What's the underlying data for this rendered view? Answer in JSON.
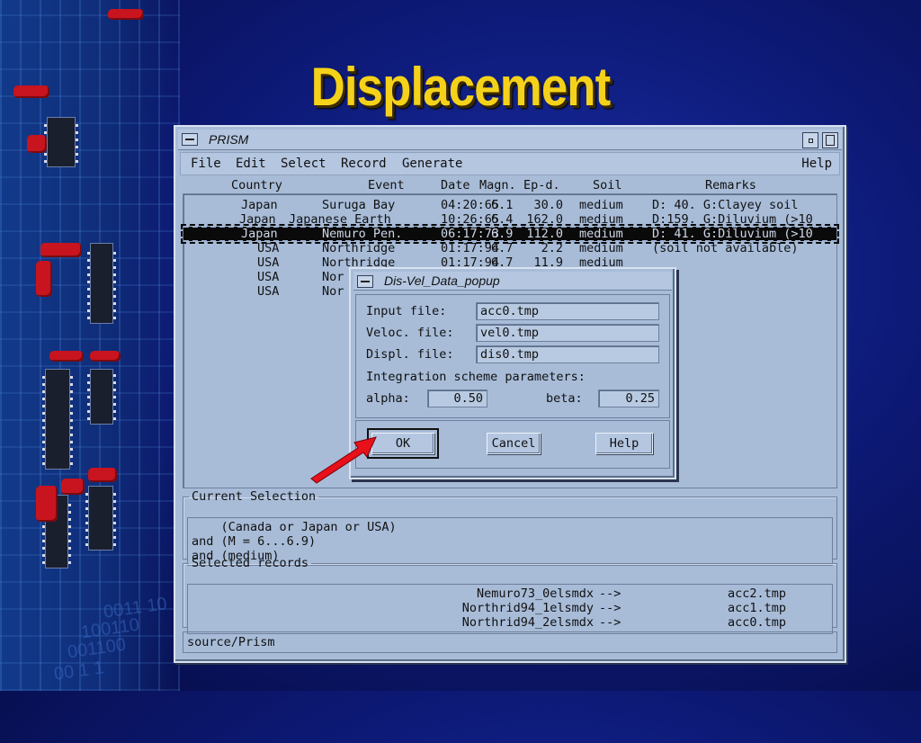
{
  "slide_title": "Displacement",
  "decor_text": [
    "0011 10",
    "100110",
    "001100",
    "00 1 1"
  ],
  "window": {
    "title": "PRISM",
    "menu": [
      "File",
      "Edit",
      "Select",
      "Record",
      "Generate"
    ],
    "help_menu": "Help",
    "columns": {
      "country": "Country",
      "event": "Event",
      "date": "Date",
      "magn": "Magn.",
      "epd": "Ep-d.",
      "soil": "Soil",
      "remarks": "Remarks"
    },
    "rows": [
      {
        "country": "Japan",
        "event": "Suruga Bay",
        "date": "04:20:65",
        "magn": "6.1",
        "epd": "30.0",
        "soil": "medium",
        "remarks": "D: 40. G:Clayey soil"
      },
      {
        "country": "Japan",
        "event": "Japanese Earth",
        "date": "10:26:65",
        "magn": "6.4",
        "epd": "162.0",
        "soil": "medium",
        "remarks": "D:159. G:Diluvium (>10"
      },
      {
        "country": "Japan",
        "event": "Nemuro Pen.",
        "date": "06:17:73",
        "magn": "6.9",
        "epd": "112.0",
        "soil": "medium",
        "remarks": "D: 41. G:Diluvium (>10"
      },
      {
        "country": "USA",
        "event": "Northridge",
        "date": "01:17:94",
        "magn": "6.7",
        "epd": "2.2",
        "soil": "medium",
        "remarks": "(soil not available)"
      },
      {
        "country": "USA",
        "event": "Northridge",
        "date": "01:17:94",
        "magn": "6.7",
        "epd": "11.9",
        "soil": "medium",
        "remarks": ""
      },
      {
        "country": "USA",
        "event": "Nor",
        "date": "",
        "magn": "",
        "epd": "",
        "soil": "",
        "remarks": ""
      },
      {
        "country": "USA",
        "event": "Nor",
        "date": "",
        "magn": "",
        "epd": "",
        "soil": "",
        "remarks": ""
      }
    ],
    "selected_row": 2,
    "current_selection": {
      "legend": "Current Selection",
      "lines": [
        "    (Canada or Japan or USA)",
        "and (M = 6...6.9)",
        "and (medium)"
      ]
    },
    "selected_records": {
      "legend": "Selected records",
      "items": [
        {
          "name": "Nemuro73_0elsmdx",
          "arrow": "-->",
          "file": "acc2.tmp"
        },
        {
          "name": "Northrid94_1elsmdy",
          "arrow": "-->",
          "file": "acc1.tmp"
        },
        {
          "name": "Northrid94_2elsmdx",
          "arrow": "-->",
          "file": "acc0.tmp"
        }
      ]
    },
    "status": "source/Prism"
  },
  "popup": {
    "title": "Dis-Vel_Data_popup",
    "input_label": "Input file:",
    "input_value": "acc0.tmp",
    "veloc_label": "Veloc. file:",
    "veloc_value": "vel0.tmp",
    "displ_label": "Displ. file:",
    "displ_value": "dis0.tmp",
    "integration_label": "Integration scheme parameters:",
    "alpha_label": "alpha:",
    "alpha_value": "0.50",
    "beta_label": "beta:",
    "beta_value": "0.25",
    "ok_label": "OK",
    "cancel_label": "Cancel",
    "help_label": "Help"
  },
  "colors": {
    "title": "#f5d21a",
    "arrow": "#e8101a",
    "window_bg": "#a8bcd8"
  }
}
